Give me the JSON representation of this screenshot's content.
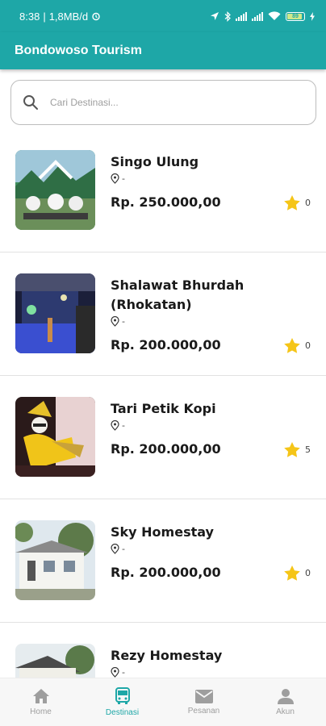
{
  "status_bar": {
    "time": "8:38",
    "net": "1,8MB/d",
    "battery": "89"
  },
  "app_bar": {
    "title": "Bondowoso Tourism"
  },
  "search": {
    "placeholder": "Cari Destinasi..."
  },
  "colors": {
    "primary": "#1ea7a7",
    "star": "#f5c518",
    "text": "#1a1a1a",
    "inactive": "#9e9e9e"
  },
  "destinations": [
    {
      "name": "Singo Ulung",
      "location": "-",
      "price": "Rp. 250.000,00",
      "rating": "0",
      "image": "festival-stage"
    },
    {
      "name": "Shalawat Bhurdah (Rhokatan)",
      "location": "-",
      "price": "Rp. 200.000,00",
      "rating": "0",
      "image": "night-performance"
    },
    {
      "name": "Tari Petik Kopi",
      "location": "-",
      "price": "Rp. 200.000,00",
      "rating": "5",
      "image": "dancer-costume"
    },
    {
      "name": "Sky Homestay",
      "location": "-",
      "price": "Rp. 200.000,00",
      "rating": "0",
      "image": "house-exterior"
    },
    {
      "name": "Rezy Homestay",
      "location": "-",
      "price": "",
      "rating": "",
      "image": "house-roof"
    }
  ],
  "bottom_nav": [
    {
      "label": "Home",
      "icon": "home-icon",
      "active": false
    },
    {
      "label": "Destinasi",
      "icon": "bus-icon",
      "active": true
    },
    {
      "label": "Pesanan",
      "icon": "mail-icon",
      "active": false
    },
    {
      "label": "Akun",
      "icon": "person-icon",
      "active": false
    }
  ]
}
